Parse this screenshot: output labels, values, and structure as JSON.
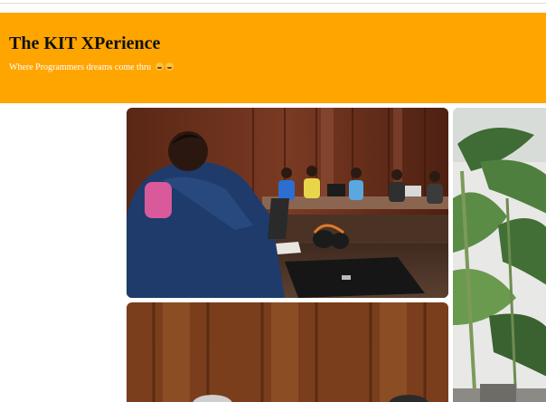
{
  "header": {
    "title": "The KIT XPerience",
    "tagline": "Where Programmers dreams come thru",
    "background_color": "#ffa500"
  },
  "gallery": {
    "photos": [
      {
        "subject": "classroom-coding-session"
      },
      {
        "subject": "banana-plant"
      },
      {
        "subject": "wood-panel-room"
      }
    ]
  }
}
